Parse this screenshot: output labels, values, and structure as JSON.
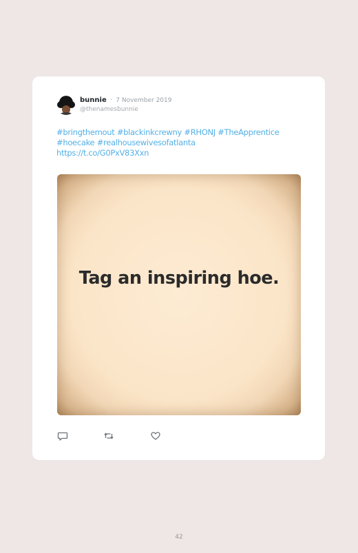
{
  "tweet": {
    "display_name": "bunnie",
    "separator": "·",
    "date": "7 November 2019",
    "handle": "@thenamesbunnie",
    "text_parts": [
      "#bringthemout",
      "#blackinkcrewny",
      "#RHONJ",
      "#TheApprentice",
      "#hoecake",
      "#realhousewivesofatlanta",
      "https://t.co/G0PxV83Xxn"
    ],
    "media_text": "Tag an inspiring hoe.",
    "icons": {
      "reply": "reply-icon",
      "retweet": "retweet-icon",
      "like": "heart-icon"
    }
  },
  "page": {
    "number": "42"
  },
  "colors": {
    "background": "#efe6e6",
    "card": "#ffffff",
    "link": "#53b0e6"
  }
}
